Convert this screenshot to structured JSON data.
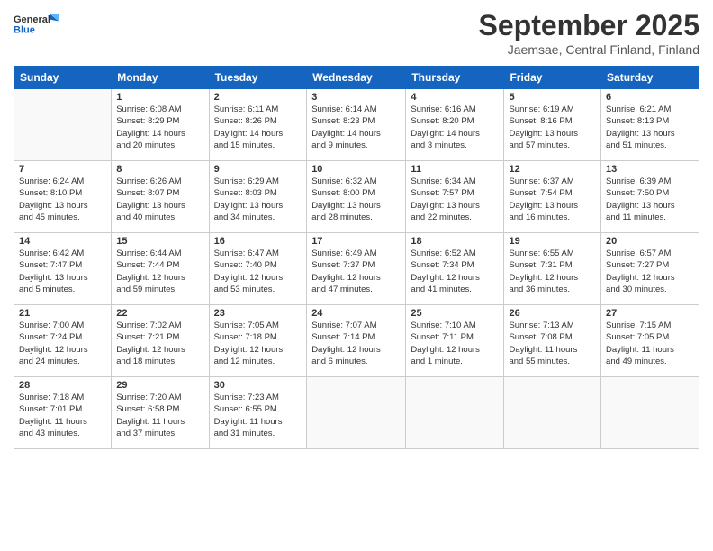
{
  "header": {
    "logo_general": "General",
    "logo_blue": "Blue",
    "month_title": "September 2025",
    "location": "Jaemsae, Central Finland, Finland"
  },
  "weekdays": [
    "Sunday",
    "Monday",
    "Tuesday",
    "Wednesday",
    "Thursday",
    "Friday",
    "Saturday"
  ],
  "weeks": [
    [
      {
        "day": "",
        "info": ""
      },
      {
        "day": "1",
        "info": "Sunrise: 6:08 AM\nSunset: 8:29 PM\nDaylight: 14 hours\nand 20 minutes."
      },
      {
        "day": "2",
        "info": "Sunrise: 6:11 AM\nSunset: 8:26 PM\nDaylight: 14 hours\nand 15 minutes."
      },
      {
        "day": "3",
        "info": "Sunrise: 6:14 AM\nSunset: 8:23 PM\nDaylight: 14 hours\nand 9 minutes."
      },
      {
        "day": "4",
        "info": "Sunrise: 6:16 AM\nSunset: 8:20 PM\nDaylight: 14 hours\nand 3 minutes."
      },
      {
        "day": "5",
        "info": "Sunrise: 6:19 AM\nSunset: 8:16 PM\nDaylight: 13 hours\nand 57 minutes."
      },
      {
        "day": "6",
        "info": "Sunrise: 6:21 AM\nSunset: 8:13 PM\nDaylight: 13 hours\nand 51 minutes."
      }
    ],
    [
      {
        "day": "7",
        "info": "Sunrise: 6:24 AM\nSunset: 8:10 PM\nDaylight: 13 hours\nand 45 minutes."
      },
      {
        "day": "8",
        "info": "Sunrise: 6:26 AM\nSunset: 8:07 PM\nDaylight: 13 hours\nand 40 minutes."
      },
      {
        "day": "9",
        "info": "Sunrise: 6:29 AM\nSunset: 8:03 PM\nDaylight: 13 hours\nand 34 minutes."
      },
      {
        "day": "10",
        "info": "Sunrise: 6:32 AM\nSunset: 8:00 PM\nDaylight: 13 hours\nand 28 minutes."
      },
      {
        "day": "11",
        "info": "Sunrise: 6:34 AM\nSunset: 7:57 PM\nDaylight: 13 hours\nand 22 minutes."
      },
      {
        "day": "12",
        "info": "Sunrise: 6:37 AM\nSunset: 7:54 PM\nDaylight: 13 hours\nand 16 minutes."
      },
      {
        "day": "13",
        "info": "Sunrise: 6:39 AM\nSunset: 7:50 PM\nDaylight: 13 hours\nand 11 minutes."
      }
    ],
    [
      {
        "day": "14",
        "info": "Sunrise: 6:42 AM\nSunset: 7:47 PM\nDaylight: 13 hours\nand 5 minutes."
      },
      {
        "day": "15",
        "info": "Sunrise: 6:44 AM\nSunset: 7:44 PM\nDaylight: 12 hours\nand 59 minutes."
      },
      {
        "day": "16",
        "info": "Sunrise: 6:47 AM\nSunset: 7:40 PM\nDaylight: 12 hours\nand 53 minutes."
      },
      {
        "day": "17",
        "info": "Sunrise: 6:49 AM\nSunset: 7:37 PM\nDaylight: 12 hours\nand 47 minutes."
      },
      {
        "day": "18",
        "info": "Sunrise: 6:52 AM\nSunset: 7:34 PM\nDaylight: 12 hours\nand 41 minutes."
      },
      {
        "day": "19",
        "info": "Sunrise: 6:55 AM\nSunset: 7:31 PM\nDaylight: 12 hours\nand 36 minutes."
      },
      {
        "day": "20",
        "info": "Sunrise: 6:57 AM\nSunset: 7:27 PM\nDaylight: 12 hours\nand 30 minutes."
      }
    ],
    [
      {
        "day": "21",
        "info": "Sunrise: 7:00 AM\nSunset: 7:24 PM\nDaylight: 12 hours\nand 24 minutes."
      },
      {
        "day": "22",
        "info": "Sunrise: 7:02 AM\nSunset: 7:21 PM\nDaylight: 12 hours\nand 18 minutes."
      },
      {
        "day": "23",
        "info": "Sunrise: 7:05 AM\nSunset: 7:18 PM\nDaylight: 12 hours\nand 12 minutes."
      },
      {
        "day": "24",
        "info": "Sunrise: 7:07 AM\nSunset: 7:14 PM\nDaylight: 12 hours\nand 6 minutes."
      },
      {
        "day": "25",
        "info": "Sunrise: 7:10 AM\nSunset: 7:11 PM\nDaylight: 12 hours\nand 1 minute."
      },
      {
        "day": "26",
        "info": "Sunrise: 7:13 AM\nSunset: 7:08 PM\nDaylight: 11 hours\nand 55 minutes."
      },
      {
        "day": "27",
        "info": "Sunrise: 7:15 AM\nSunset: 7:05 PM\nDaylight: 11 hours\nand 49 minutes."
      }
    ],
    [
      {
        "day": "28",
        "info": "Sunrise: 7:18 AM\nSunset: 7:01 PM\nDaylight: 11 hours\nand 43 minutes."
      },
      {
        "day": "29",
        "info": "Sunrise: 7:20 AM\nSunset: 6:58 PM\nDaylight: 11 hours\nand 37 minutes."
      },
      {
        "day": "30",
        "info": "Sunrise: 7:23 AM\nSunset: 6:55 PM\nDaylight: 11 hours\nand 31 minutes."
      },
      {
        "day": "",
        "info": ""
      },
      {
        "day": "",
        "info": ""
      },
      {
        "day": "",
        "info": ""
      },
      {
        "day": "",
        "info": ""
      }
    ]
  ]
}
